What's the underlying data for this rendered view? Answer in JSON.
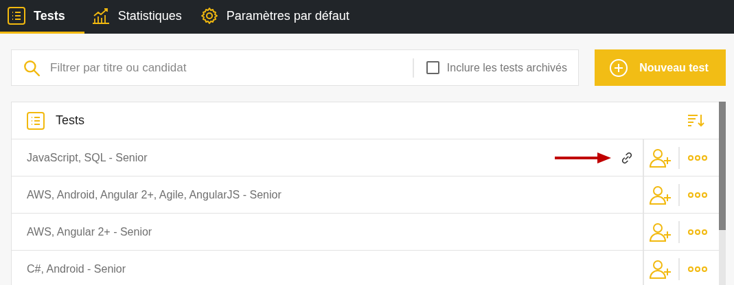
{
  "nav": {
    "tabs": [
      {
        "label": "Tests",
        "selected": true
      },
      {
        "label": "Statistiques",
        "selected": false
      },
      {
        "label": "Paramètres par défaut",
        "selected": false
      }
    ]
  },
  "filter": {
    "placeholder": "Filtrer par titre ou candidat",
    "archived": {
      "label": "Inclure les tests archivés",
      "checked": false
    }
  },
  "new_button": {
    "label": "Nouveau test"
  },
  "panel": {
    "title": "Tests",
    "rows": [
      {
        "title": "JavaScript, SQL - Senior",
        "link_icon": true,
        "arrow": true
      },
      {
        "title": "AWS, Android, Angular 2+, Agile, AngularJS - Senior",
        "link_icon": false,
        "arrow": false
      },
      {
        "title": "AWS, Angular 2+ - Senior",
        "link_icon": false,
        "arrow": false
      },
      {
        "title": "C#, Android - Senior",
        "link_icon": false,
        "arrow": false
      }
    ]
  }
}
